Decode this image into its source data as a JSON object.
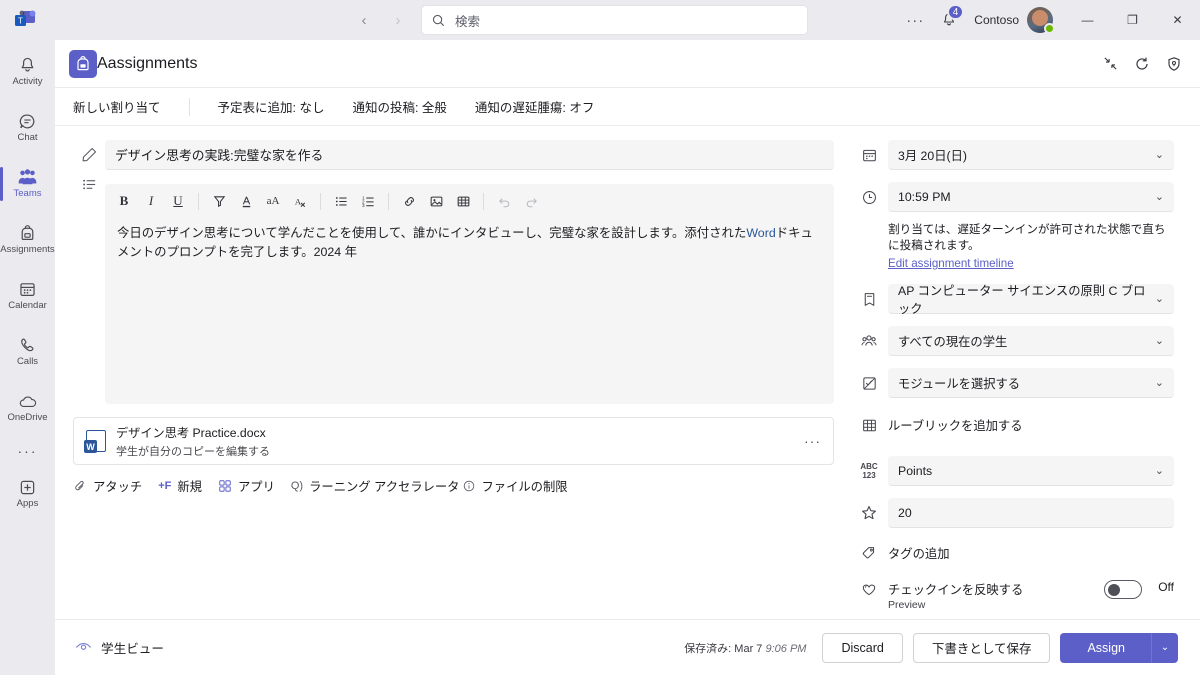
{
  "titlebar": {
    "nav": {
      "back": "‹",
      "forward": "›"
    },
    "search": {
      "placeholder": "検索",
      "icon": "search-icon"
    },
    "overflow": "···",
    "notifications": {
      "icon": "bell-icon",
      "badge": "4"
    },
    "tenant": "Contoso",
    "window": {
      "minimize": "—",
      "maximize": "❐",
      "close": "✕"
    }
  },
  "rail": {
    "items": [
      {
        "label": "Activity",
        "icon": "bell-icon",
        "active": false
      },
      {
        "label": "Chat",
        "icon": "chat-icon",
        "active": false
      },
      {
        "label": "Teams",
        "icon": "teams-icon",
        "active": true
      },
      {
        "label": "Assignments",
        "icon": "backpack-icon",
        "active": false
      },
      {
        "label": "Calendar",
        "icon": "calendar-icon",
        "active": false
      },
      {
        "label": "Calls",
        "icon": "phone-icon",
        "active": false
      },
      {
        "label": "OneDrive",
        "icon": "cloud-icon",
        "active": false
      }
    ],
    "more": "···",
    "apps": {
      "label": "Apps",
      "icon": "apps-plus-icon"
    }
  },
  "app_header": {
    "title": "Aassignments",
    "icon": "backpack-icon",
    "actions": [
      "collapse-icon",
      "refresh-icon",
      "shield-icon"
    ]
  },
  "subbar": {
    "new_assignment": "新しい割り当て",
    "add_to_calendar": "予定表に追加: なし",
    "notify_post": "通知の投稿: 全般",
    "notify_late": "通知の遅延腫瘍: オフ"
  },
  "form": {
    "title_value": "デザイン思考の実践:完璧な家を作る",
    "format_buttons": [
      "bold-icon",
      "italic-icon",
      "underline-icon",
      "highlight-icon",
      "font-color-icon",
      "font-size-icon",
      "clear-format-icon",
      "bullet-list-icon",
      "numbered-list-icon",
      "link-icon",
      "image-icon",
      "table-icon",
      "undo-icon",
      "redo-icon"
    ],
    "description_part1": "今日のデザイン思考について学んだことを使用して、誰かにインタビューし、完璧な家を設計します。添付された",
    "description_word": "Word",
    "description_part2": "ドキュメントのプロンプトを完了します。2024 年",
    "attachment": {
      "name": "デザイン思考 Practice.docx",
      "subtitle": "学生が自分のコピーを編集する",
      "more": "···"
    },
    "actions": [
      {
        "label": "アタッチ",
        "icon": "paperclip-icon"
      },
      {
        "label": "新規",
        "icon": "plus-f-icon"
      },
      {
        "label": "アプリ",
        "icon": "apps-grid-icon"
      },
      {
        "label": "ラーニング アクセラレータ",
        "icon": "learning-accelerator-icon"
      },
      {
        "label": "ファイルの制限",
        "icon": "info-icon"
      }
    ]
  },
  "panel": {
    "due_date": "3月 20日(日)",
    "due_time": "10:59 PM",
    "timeline_note": "割り当ては、遅延ターンインが許可された状態で直ちに投稿されます。",
    "timeline_link": "Edit assignment timeline",
    "class": "AP コンピューター サイエンスの原則 C ブロック",
    "students": "すべての現在の学生",
    "module": "モジュールを選択する",
    "rubric": "ルーブリックを追加する",
    "points_type": "Points",
    "points_value": "20",
    "tags": "タグの追加",
    "checkin_label": "チェックインを反映する",
    "checkin_sub": "Preview",
    "checkin_state": "Off",
    "chevron": "⌄"
  },
  "footer": {
    "student_view": "学生ビュー",
    "saved": "保存済み: Mar 7",
    "saved_time": "9:06 PM",
    "discard": "Discard",
    "save_draft": "下書きとして保存",
    "assign": "Assign",
    "assign_carat": "⌄"
  },
  "colors": {
    "accent": "#5b5fc7",
    "rail_bg": "#ebebef",
    "field_bg": "#f5f5f5",
    "presence": "#6bb700"
  }
}
